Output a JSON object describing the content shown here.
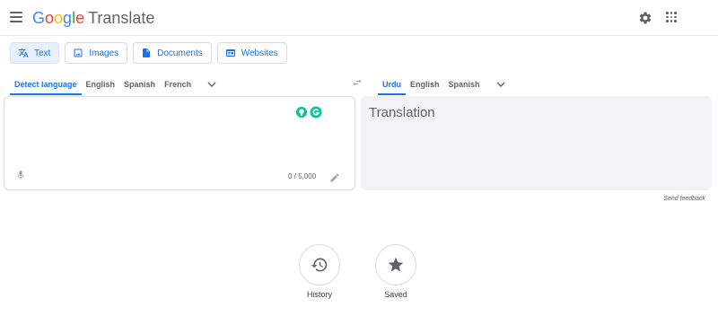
{
  "header": {
    "logo_letters": [
      "G",
      "o",
      "o",
      "g",
      "l",
      "e"
    ],
    "product_name": "Translate",
    "icons": {
      "menu": "hamburger-menu-icon",
      "settings": "gear-icon",
      "apps": "apps-grid-icon"
    }
  },
  "modes": [
    {
      "label": "Text",
      "icon": "translate-icon",
      "active": true
    },
    {
      "label": "Images",
      "icon": "image-icon",
      "active": false
    },
    {
      "label": "Documents",
      "icon": "document-icon",
      "active": false
    },
    {
      "label": "Websites",
      "icon": "website-icon",
      "active": false
    }
  ],
  "source_languages": [
    {
      "label": "Detect language",
      "active": true
    },
    {
      "label": "English",
      "active": false
    },
    {
      "label": "Spanish",
      "active": false
    },
    {
      "label": "French",
      "active": false
    }
  ],
  "target_languages": [
    {
      "label": "Urdu",
      "active": true
    },
    {
      "label": "English",
      "active": false
    },
    {
      "label": "Spanish",
      "active": false
    }
  ],
  "source_panel": {
    "value": "",
    "char_count": "0 / 5,000",
    "extensions": [
      "extension-bulb-icon",
      "grammarly-icon"
    ]
  },
  "target_panel": {
    "placeholder": "Translation"
  },
  "feedback_label": "Send feedback",
  "bottom": {
    "history_label": "History",
    "saved_label": "Saved"
  },
  "colors": {
    "accent": "#1a73e8",
    "active_mode_bg": "#e8f0fe",
    "target_panel_bg": "#f1f3f4",
    "grammarly": "#15c39a"
  }
}
